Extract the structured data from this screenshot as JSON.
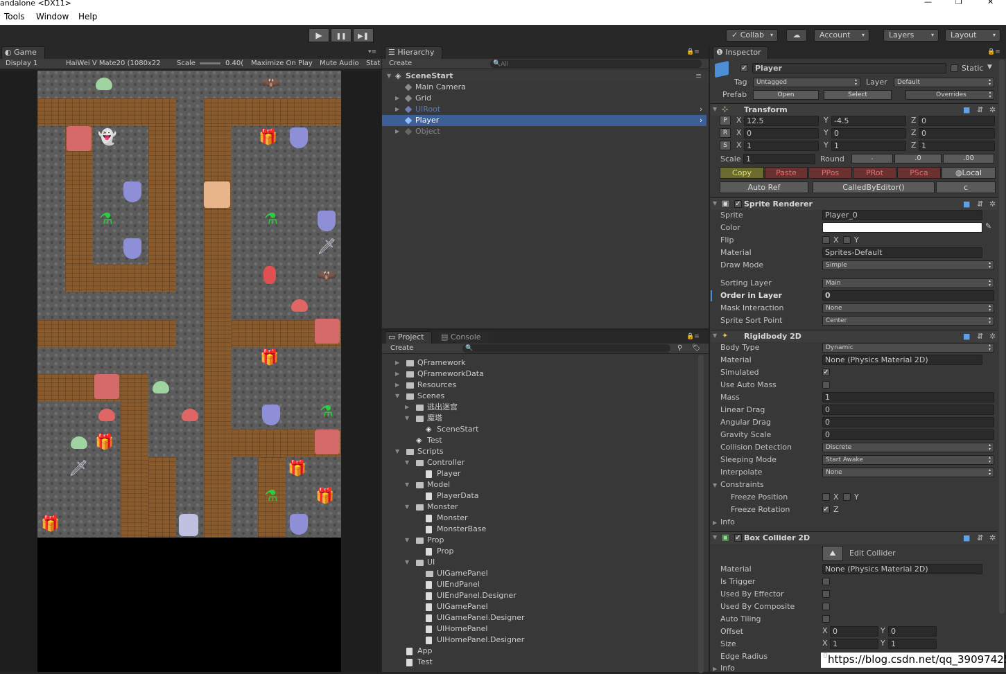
{
  "window": {
    "title": "andalone <DX11>",
    "controls": [
      "—",
      "❐",
      "✕"
    ]
  },
  "menu": [
    "Tools",
    "Window",
    "Help"
  ],
  "toolbar": {
    "play": "▶",
    "pause": "❚❚",
    "step": "▶❚",
    "collab": "Collab",
    "account": "Account",
    "layers": "Layers",
    "layout": "Layout",
    "cloud": "☁",
    "check": "✓"
  },
  "game": {
    "tab": "Game",
    "display": "Display 1",
    "resolution": "HaiWei V Mate20 (1080x22",
    "scale_label": "Scale",
    "scale_value": "0.40(",
    "maximize": "Maximize On Play",
    "mute": "Mute Audio",
    "stats": "Stat"
  },
  "hierarchy": {
    "tab": "Hierarchy",
    "create": "Create",
    "search": "All",
    "scene": "SceneStart",
    "items": [
      "Main Camera",
      "Grid",
      "UIRoot",
      "Player",
      "Object"
    ]
  },
  "project": {
    "tab": "Project",
    "console": "Console",
    "create": "Create",
    "items": [
      "QFramework",
      "QFrameworkData",
      "Resources",
      "Scenes",
      "逃出迷宫",
      "魔塔",
      "SceneStart",
      "Test",
      "Scripts",
      "Controller",
      "Player",
      "Model",
      "PlayerData",
      "Monster",
      "Monster",
      "MonsterBase",
      "Prop",
      "Prop",
      "UI",
      "UIGamePanel",
      "UIEndPanel",
      "UIEndPanel.Designer",
      "UIGamePanel",
      "UIGamePanel.Designer",
      "UIHomePanel",
      "UIHomePanel.Designer",
      "App",
      "Test"
    ]
  },
  "inspector": {
    "tab": "Inspector",
    "name": "Player",
    "static": "Static",
    "tag_label": "Tag",
    "tag": "Untagged",
    "layer_label": "Layer",
    "layer": "Default",
    "prefab_label": "Prefab",
    "open": "Open",
    "select": "Select",
    "overrides": "Overrides",
    "transform": {
      "title": "Transform",
      "px": "12.5",
      "py": "-4.5",
      "pz": "0",
      "rx": "0",
      "ry": "0",
      "rz": "0",
      "sx": "1",
      "sy": "1",
      "sz": "1",
      "scale_label": "Scale",
      "scale": "1",
      "round": "Round",
      "r1": ".",
      "r2": ".0",
      "r3": ".00",
      "copy": "Copy",
      "paste": "Paste",
      "ppos": "PPos",
      "prot": "PRot",
      "psca": "PSca",
      "local": "Local",
      "autoref": "Auto Ref",
      "called": "CalledByEditor()",
      "c": "c"
    },
    "sprite_renderer": {
      "title": "Sprite Renderer",
      "sprite_l": "Sprite",
      "sprite": "Player_0",
      "color_l": "Color",
      "flip_l": "Flip",
      "material_l": "Material",
      "material": "Sprites-Default",
      "drawmode_l": "Draw Mode",
      "drawmode": "Simple",
      "sorting_l": "Sorting Layer",
      "sorting": "Main",
      "order_l": "Order in Layer",
      "order": "0",
      "mask_l": "Mask Interaction",
      "mask": "None",
      "sort_l": "Sprite Sort Point",
      "sort": "Center"
    },
    "rigidbody": {
      "title": "Rigidbody 2D",
      "bodytype_l": "Body Type",
      "bodytype": "Dynamic",
      "material_l": "Material",
      "material": "None (Physics Material 2D)",
      "simulated_l": "Simulated",
      "autoMass_l": "Use Auto Mass",
      "mass_l": "Mass",
      "mass": "1",
      "linear_l": "Linear Drag",
      "linear": "0",
      "angular_l": "Angular Drag",
      "angular": "0",
      "gravity_l": "Gravity Scale",
      "gravity": "0",
      "collision_l": "Collision Detection",
      "collision": "Discrete",
      "sleeping_l": "Sleeping Mode",
      "sleeping": "Start Awake",
      "interp_l": "Interpolate",
      "interp": "None",
      "constraints_l": "Constraints",
      "freezepos_l": "Freeze Position",
      "freezerot_l": "Freeze Rotation",
      "info": "Info"
    },
    "box_collider": {
      "title": "Box Collider 2D",
      "edit": "Edit Collider",
      "material_l": "Material",
      "material": "None (Physics Material 2D)",
      "trigger_l": "Is Trigger",
      "effector_l": "Used By Effector",
      "composite_l": "Used By Composite",
      "tiling_l": "Auto Tiling",
      "offset_l": "Offset",
      "ox": "0",
      "oy": "0",
      "size_l": "Size",
      "sx": "1",
      "sy": "1",
      "radius_l": "Edge Radius",
      "radius": "0",
      "info": "Info"
    },
    "axis": {
      "x": "X",
      "y": "Y",
      "z": "Z"
    }
  },
  "watermark": "https://blog.csdn.net/qq_39097425",
  "colors": {
    "selection": "#3e5f96",
    "panel": "#383838",
    "wall": "#8b5a2b",
    "floor": "#5c5c5c"
  }
}
